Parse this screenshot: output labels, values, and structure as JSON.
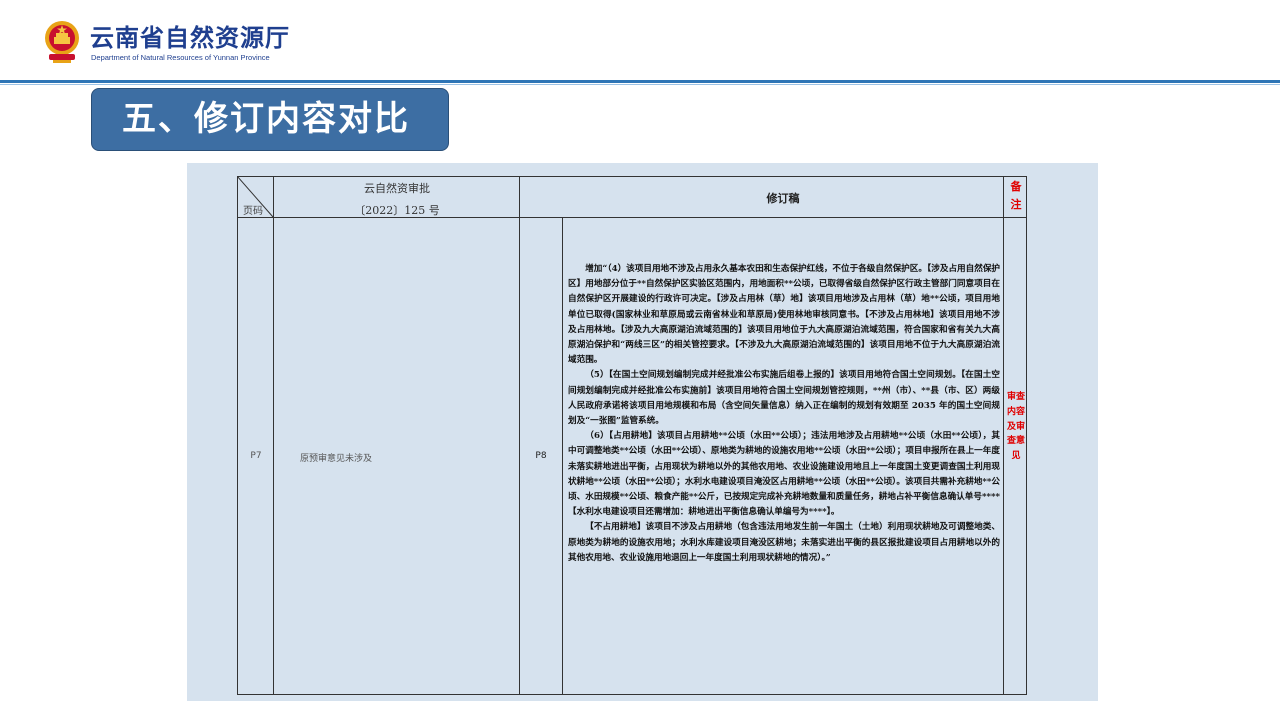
{
  "header": {
    "org_name_cn": "云南省自然资源厅",
    "org_name_en": "Department of Natural Resources of Yunnan Province",
    "emblem_icon": "national-emblem-icon",
    "accent_color": "#2e75b6"
  },
  "section": {
    "title": "五、修订内容对比",
    "color": "#3d6ea3"
  },
  "table": {
    "header_page": "页码",
    "header_original_line1": "云自然资审批",
    "header_original_line2": "〔2022〕125 号",
    "header_revised": "修订稿",
    "header_note": "备注",
    "row": {
      "page_original": "P7",
      "original_content": "原预审意见未涉及",
      "page_revised": "P8",
      "revised_paragraphs": [
        "增加“（4）该项目用地不涉及占用永久基本农田和生态保护红线，不位于各级自然保护区。【涉及占用自然保护区】用地部分位于**自然保护区实验区范围内，用地面积**公顷，已取得省级自然保护区行政主管部门同意项目在自然保护区开展建设的行政许可决定。【涉及占用林（草）地】该项目用地涉及占用林（草）地**公顷，项目用地单位已取得(国家林业和草原局或云南省林业和草原局)使用林地审核同意书。【不涉及占用林地】该项目用地不涉及占用林地。【涉及九大高原湖泊流域范围的】该项目用地位于九大高原湖泊流域范围，符合国家和省有关九大高原湖泊保护和“两线三区”的相关管控要求。【不涉及九大高原湖泊流域范围的】该项目用地不位于九大高原湖泊流域范围。",
        "（5）【在国土空间规划编制完成并经批准公布实施后组卷上报的】该项目用地符合国土空间规划。【在国土空间规划编制完成并经批准公布实施前】该项目用地符合国土空间规划管控规则，**州（市）、**县（市、区）两级人民政府承诺将该项目用地规模和布局（含空间矢量信息）纳入正在编制的规划有效期至 2035 年的国土空间规划及“一张图”监管系统。",
        "（6）【占用耕地】该项目占用耕地**公顷（水田**公顷）；违法用地涉及占用耕地**公顷（水田**公顷），其中可调整地类**公顷（水田**公顷）、原地类为耕地的设施农用地**公顷（水田**公顷）；项目申报所在县上一年度未落实耕地进出平衡，占用现状为耕地以外的其他农用地、农业设施建设用地且上一年度国土变更调查国土利用现状耕地**公顷（水田**公顷）；水利水电建设项目淹没区占用耕地**公顷（水田**公顷）。该项目共需补充耕地**公顷、水田规模**公顷、粮食产能**公斤，已按规定完成补充耕地数量和质量任务，耕地占补平衡信息确认单号****【水利水电建设项目还需增加：耕地进出平衡信息确认单编号为****】。",
        "【不占用耕地】该项目不涉及占用耕地（包含违法用地发生前一年国土（土地）利用现状耕地及可调整地类、原地类为耕地的设施农用地；水利水库建设项目淹没区耕地；未落实进出平衡的县区报批建设项目占用耕地以外的其他农用地、农业设施用地退回上一年度国土利用现状耕地的情况）。”"
      ],
      "note": "审查内容及审查意见",
      "note_color": "#e00000"
    }
  }
}
